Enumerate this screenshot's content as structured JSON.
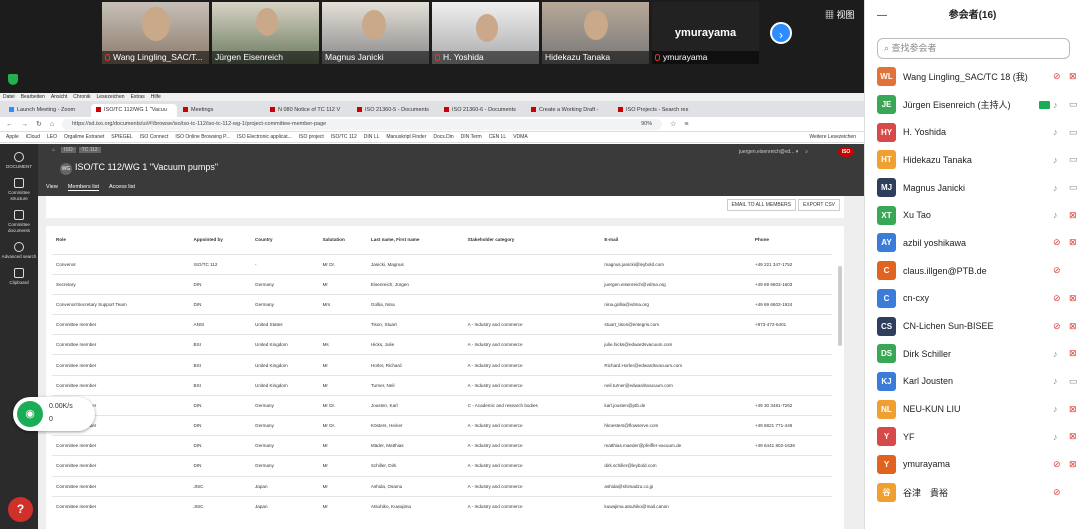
{
  "meeting": {
    "view_label": "视图",
    "security_icon": "shield-icon",
    "tiles": [
      {
        "name": "Wang Lingling_SAC/T...",
        "muted": true
      },
      {
        "name": "Jürgen Eisenreich",
        "muted": false
      },
      {
        "name": "Magnus Janicki",
        "muted": false
      },
      {
        "name": "H. Yoshida",
        "muted": true
      },
      {
        "name": "Hidekazu Tanaka",
        "muted": false
      },
      {
        "name": "ymurayama",
        "muted": true,
        "big": "ymurayama"
      }
    ]
  },
  "browser": {
    "menu": [
      "Datei",
      "Bearbeiten",
      "Ansicht",
      "Chronik",
      "Lesezeichen",
      "Extras",
      "Hilfe"
    ],
    "tabs": [
      "Launch Meeting - Zoom",
      "ISO/TC 112/WG 1 \"Vacuu",
      "Meetings",
      "N 080 Notice of TC 112 V",
      "ISO 21360-5 - Documents",
      "ISO 21360-6 - Documents",
      "Create a Working Draft -",
      "ISO Projects - Search res"
    ],
    "url": "https://sd.iso.org/documents/ui/#!/browse/iso/iso-tc-112/iso-tc-112-wg-1/project-committee-member-page",
    "zoom": "90%",
    "bookmarks": [
      "Apple",
      "iCloud",
      "LEO",
      "Orgalime Extranet",
      "SPIEGEL",
      "ISO Connect",
      "ISO Online Browsing P...",
      "ISO Electronic applicat...",
      "ISO project",
      "ISO/TC 112",
      "DIN LL",
      "Manuskript Finder",
      "Docs.Din",
      "DIN Term",
      "CEN LL",
      "VDMA",
      "Weitere Lesezeichen"
    ]
  },
  "iso": {
    "breadcrumb": [
      "ISO",
      "TC 112"
    ],
    "user": "juergen.eisenreich@vd...",
    "title": "ISO/TC 112/WG 1 \"Vacuum pumps\"",
    "wg_badge": "WG",
    "subtabs": [
      "View",
      "Members list",
      "Access list"
    ],
    "nav": [
      "DOCUMENT",
      "Committee structure",
      "Committee documents",
      "Advanced search",
      "Clipboard"
    ],
    "email_btn": "EMAIL TO ALL MEMBERS",
    "export_btn": "EXPORT CSV",
    "columns": [
      "Role",
      "Appointed by",
      "Country",
      "Salutation",
      "Last name, First name",
      "Stakeholder category",
      "E-mail",
      "Phone"
    ],
    "rows": [
      [
        "Convenor",
        "ISO/TC 112",
        "-",
        "Mr Dr.",
        "Janicki, Magnus",
        "",
        "magnus.janicki@leybold.com",
        "+49 221 347-1752"
      ],
      [
        "Secretary",
        "DIN",
        "Germany",
        "Mr",
        "Eisenreich, Jürgen",
        "",
        "juergen.eisenreich@vdma.org",
        "+49 69 6603-1603"
      ],
      [
        "Convenor/Secretary Support Team",
        "DIN",
        "Germany",
        "Mrs",
        "Gollia, Nina",
        "",
        "nina.gollia@vdma.org",
        "+49 69 6603-1924"
      ],
      [
        "Committee member",
        "ANSI",
        "United States",
        "",
        "Tison, Stuart",
        "A - Industry and commerce",
        "stuart_tison@entegris.com",
        "+973-472-6401"
      ],
      [
        "Committee member",
        "BSI",
        "United Kingdom",
        "Ms",
        "Hicks, Julie",
        "A - Industry and commerce",
        "julie.hicks@edwardsvacuum.com",
        ""
      ],
      [
        "Committee member",
        "BSI",
        "United Kingdom",
        "Mr",
        "Horler, Richard",
        "A - Industry and commerce",
        "Richard.Horler@edwardsvacuum.com",
        ""
      ],
      [
        "Committee member",
        "BSI",
        "United Kingdom",
        "Mr",
        "Turner, Neil",
        "A - Industry and commerce",
        "neil.turner@edwardsvacuum.com",
        ""
      ],
      [
        "Committee member",
        "DIN",
        "Germany",
        "Mr Dr.",
        "Jousten, Karl",
        "C - Academic and research bodies",
        "karl.jousten@ptb.de",
        "+49 30 3481-7262"
      ],
      [
        "Committee member",
        "DIN",
        "Germany",
        "Mr Dr.",
        "Kösters, Heiner",
        "A - Industry and commerce",
        "hkoesters@flowserve.com",
        "+49 6821 771-446"
      ],
      [
        "Committee member",
        "DIN",
        "Germany",
        "Mr",
        "Mäder, Matthias",
        "A - Industry and commerce",
        "matthias.maeder@pfeiffer-vacuum.de",
        "+49 6441 802-1636"
      ],
      [
        "Committee member",
        "DIN",
        "Germany",
        "Mr",
        "Schiller, Dirk",
        "A - Industry and commerce",
        "dirk.schiller@leybold.com",
        ""
      ],
      [
        "Committee member",
        "JISC",
        "Japan",
        "Mr",
        "Ashida, Osamu",
        "A - Industry and commerce",
        "ashida@shimadzu.co.jp",
        ""
      ],
      [
        "Committee member",
        "JISC",
        "Japan",
        "Mr",
        "Atsuhiko, Kuwajima",
        "A - Industry and commerce",
        "kuwajima.atsuhiko@mail.canon",
        ""
      ]
    ],
    "net_up": "0.00K/s",
    "net_down": "0",
    "help": "?"
  },
  "panel": {
    "title": "参会者(16)",
    "minimize": "—",
    "search_placeholder": "查找参会者",
    "participants": [
      {
        "initials": "WL",
        "color": "#e0723a",
        "name": "Wang Lingling_SAC/TC 18 (我)",
        "mic": "muted",
        "cam": "off"
      },
      {
        "initials": "JE",
        "color": "#3aa757",
        "name": "Jürgen Eisenreich (主持人)",
        "mic": "on",
        "cam": "on",
        "host": true
      },
      {
        "initials": "HY",
        "color": "#d84a4a",
        "name": "H. Yoshida",
        "mic": "on",
        "cam": "on"
      },
      {
        "initials": "HT",
        "color": "#f0a030",
        "name": "Hidekazu Tanaka",
        "mic": "on",
        "cam": "on"
      },
      {
        "initials": "MJ",
        "color": "#2f3e5c",
        "name": "Magnus Janicki",
        "mic": "on",
        "cam": "on"
      },
      {
        "initials": "XT",
        "color": "#3aa757",
        "name": "Xu Tao",
        "mic": "on",
        "cam": "off"
      },
      {
        "initials": "AY",
        "color": "#3b7bd9",
        "name": "azbil yoshikawa",
        "mic": "muted",
        "cam": "off"
      },
      {
        "initials": "C",
        "color": "#e06420",
        "name": "claus.illgen@PTB.de",
        "mic": "muted",
        "cam": ""
      },
      {
        "initials": "C",
        "color": "#3b7bd9",
        "name": "cn-cxy",
        "mic": "muted",
        "cam": "off"
      },
      {
        "initials": "CS",
        "color": "#2f3e5c",
        "name": "CN-Lichen Sun-BISEE",
        "mic": "muted",
        "cam": "off"
      },
      {
        "initials": "DS",
        "color": "#3aa757",
        "name": "Dirk Schiller",
        "mic": "on",
        "cam": "off"
      },
      {
        "initials": "KJ",
        "color": "#3b7bd9",
        "name": "Karl Jousten",
        "mic": "on",
        "cam": "on"
      },
      {
        "initials": "NL",
        "color": "#f0a030",
        "name": "NEU-KUN LIU",
        "mic": "on",
        "cam": "off"
      },
      {
        "initials": "Y",
        "color": "#d84a4a",
        "name": "YF",
        "mic": "on",
        "cam": "off"
      },
      {
        "initials": "Y",
        "color": "#e06420",
        "name": "ymurayama",
        "mic": "muted",
        "cam": "off"
      },
      {
        "initials": "谷",
        "color": "#f0a030",
        "name": "谷津　貴裕",
        "mic": "muted",
        "cam": ""
      }
    ]
  }
}
